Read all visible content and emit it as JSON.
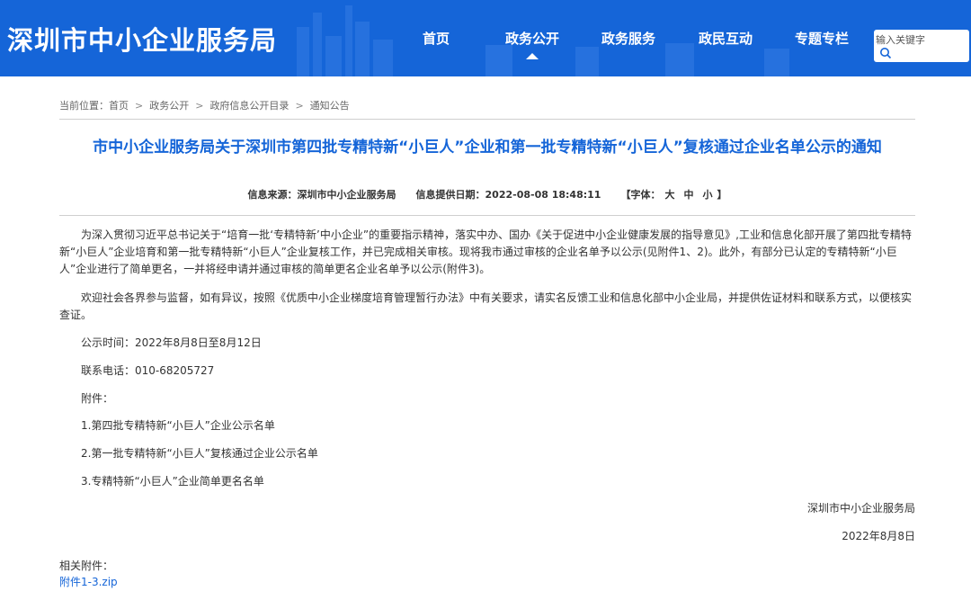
{
  "header": {
    "site_title": "深圳市中小企业服务局",
    "nav": [
      "首页",
      "政务公开",
      "政务服务",
      "政民互动",
      "专题专栏"
    ],
    "active_nav": "政务公开",
    "search_placeholder": "输入关键字",
    "brand_color": "#1565d8"
  },
  "breadcrumb": {
    "label": "当前位置：",
    "items": [
      "首页",
      "政务公开",
      "政府信息公开目录",
      "通知公告"
    ],
    "separator": ">"
  },
  "article": {
    "title": "市中小企业服务局关于深圳市第四批专精特新“小巨人”企业和第一批专精特新“小巨人”复核通过企业名单公示的通知",
    "source_label": "信息来源：",
    "source": "深圳市中小企业服务局",
    "date_label": "信息提供日期：",
    "date": "2022-08-08 18:48:11",
    "fontsize_open": "【字体：",
    "fontsize_large": "大",
    "fontsize_medium": "中",
    "fontsize_small": "小",
    "fontsize_close": "】",
    "paragraphs": [
      "为深入贯彻习近平总书记关于“培育一批‘专精特新’中小企业”的重要指示精神，落实中办、国办《关于促进中小企业健康发展的指导意见》,工业和信息化部开展了第四批专精特新“小巨人”企业培育和第一批专精特新“小巨人”企业复核工作，并已完成相关审核。现将我市通过审核的企业名单予以公示(见附件1、2)。此外，有部分已认定的专精特新“小巨人”企业进行了简单更名，一并将经申请并通过审核的简单更名企业名单予以公示(附件3)。",
      "欢迎社会各界参与监督，如有异议，按照《优质中小企业梯度培育管理暂行办法》中有关要求，请实名反馈工业和信息化部中小企业局，并提供佐证材料和联系方式，以便核实查证。"
    ],
    "publicity_time": "公示时间：2022年8月8日至8月12日",
    "phone": "联系电话：010-68205727",
    "attachments_label": "附件：",
    "attachment_items": [
      "1.第四批专精特新“小巨人”企业公示名单",
      "2.第一批专精特新“小巨人”复核通过企业公示名单",
      "3.专精特新“小巨人”企业简单更名名单"
    ],
    "signature": "深圳市中小企业服务局",
    "sign_date": "2022年8月8日"
  },
  "related": {
    "label": "相关附件：",
    "file": "附件1-3.zip"
  }
}
